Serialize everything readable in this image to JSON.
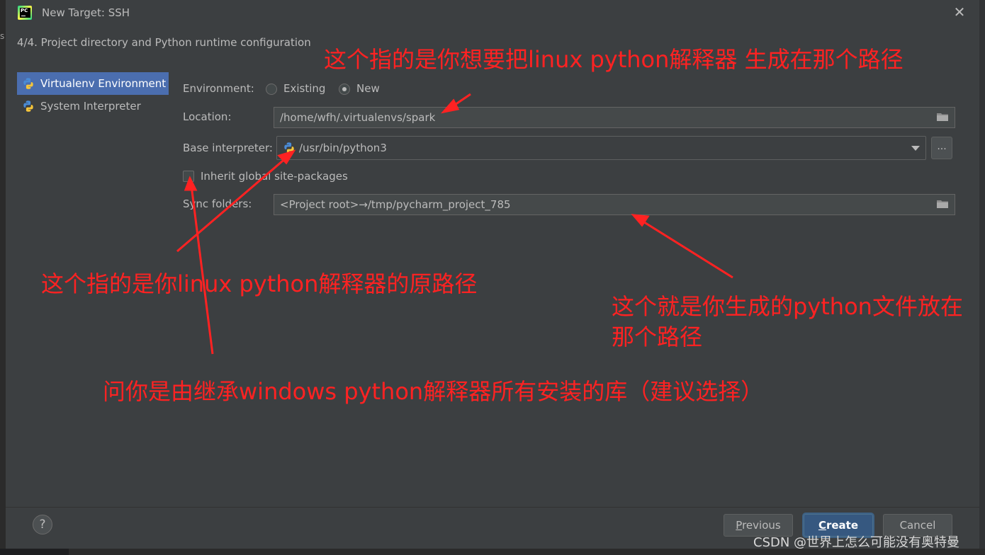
{
  "window": {
    "title": "New Target: SSH",
    "close_glyph": "✕"
  },
  "edge_glyph": "s",
  "step_header": "4/4. Project directory and Python runtime configuration",
  "sidebar": {
    "items": [
      {
        "label": "Virtualenv Environment",
        "icon": "python-icon",
        "selected": true
      },
      {
        "label": "System Interpreter",
        "icon": "python-icon",
        "selected": false
      }
    ]
  },
  "form": {
    "environment_label": "Environment:",
    "options": [
      {
        "label": "Existing",
        "checked": false
      },
      {
        "label": "New",
        "checked": true
      }
    ],
    "location_label": "Location:",
    "location_value": "/home/wfh/.virtualenvs/spark",
    "base_interpreter_label": "Base interpreter:",
    "base_interpreter_value": "/usr/bin/python3",
    "browse_label": "...",
    "inherit_label": "Inherit global site-packages",
    "inherit_checked": false,
    "sync_label": "Sync folders:",
    "sync_value": "<Project root>→/tmp/pycharm_project_785"
  },
  "annotations": {
    "location_note": "这个指的是你想要把linux python解释器 生成在那个路径",
    "interpreter_note": "这个指的是你linux python解释器的原路径",
    "sync_note_line1": "这个就是你生成的python文件放在",
    "sync_note_line2": "那个路径",
    "inherit_note": "问你是由继承windows python解释器所有安装的库（建议选择）",
    "arrow_color": "#ff2222"
  },
  "footer": {
    "help_label": "?",
    "previous_mnemonic": "P",
    "previous_rest": "revious",
    "create_mnemonic": "C",
    "create_rest": "reate",
    "cancel_label": "Cancel"
  },
  "watermark": "CSDN @世界上怎么可能没有奥特曼",
  "colors": {
    "accent": "#4b6eaf",
    "primary_button": "#365880",
    "background": "#3c3f41"
  }
}
